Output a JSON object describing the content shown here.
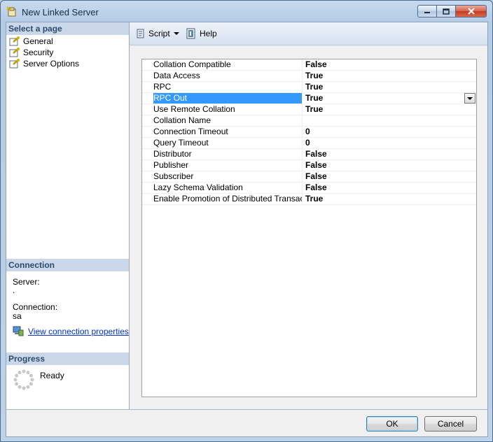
{
  "window": {
    "title": "New Linked Server"
  },
  "left_panel": {
    "select_page_header": "Select a page",
    "pages": [
      {
        "label": "General",
        "icon": "page-wrench-icon"
      },
      {
        "label": "Security",
        "icon": "page-wrench-icon"
      },
      {
        "label": "Server Options",
        "icon": "page-wrench-icon",
        "selected": true
      }
    ],
    "connection_header": "Connection",
    "server_label": "Server:",
    "server_value": ".",
    "connection_label": "Connection:",
    "connection_value": "sa",
    "view_props_link": "View connection properties",
    "progress_header": "Progress",
    "progress_status": "Ready"
  },
  "toolbar": {
    "script_label": "Script",
    "help_label": "Help"
  },
  "options": [
    {
      "name": "Collation Compatible",
      "value": "False"
    },
    {
      "name": "Data Access",
      "value": "True"
    },
    {
      "name": "RPC",
      "value": "True"
    },
    {
      "name": "RPC Out",
      "value": "True",
      "selected": true
    },
    {
      "name": "Use Remote Collation",
      "value": "True"
    },
    {
      "name": "Collation Name",
      "value": ""
    },
    {
      "name": "Connection Timeout",
      "value": "0"
    },
    {
      "name": "Query Timeout",
      "value": "0"
    },
    {
      "name": "Distributor",
      "value": "False"
    },
    {
      "name": "Publisher",
      "value": "False"
    },
    {
      "name": "Subscriber",
      "value": "False"
    },
    {
      "name": "Lazy Schema Validation",
      "value": "False"
    },
    {
      "name": "Enable Promotion of Distributed Transactions",
      "value": "True"
    }
  ],
  "buttons": {
    "ok": "OK",
    "cancel": "Cancel"
  },
  "colors": {
    "selection": "#3399ff",
    "link": "#0033cc",
    "section_header": "#c9d7e8"
  }
}
